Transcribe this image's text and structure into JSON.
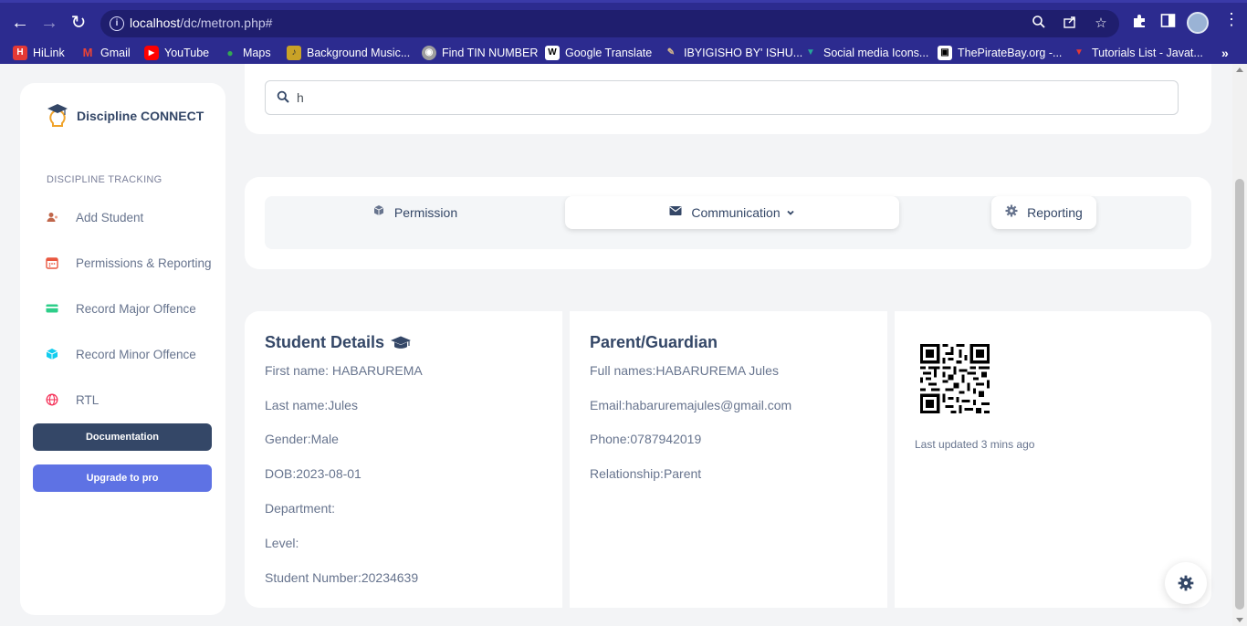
{
  "browser": {
    "url_host": "localhost",
    "url_path": "/dc/metron.php#",
    "bookmarks": [
      {
        "label": "HiLink",
        "color": "#e53935",
        "glyph": "H"
      },
      {
        "label": "Gmail",
        "color": "#ea4335",
        "glyph": "M"
      },
      {
        "label": "YouTube",
        "color": "#ff0000",
        "glyph": "▶"
      },
      {
        "label": "Maps",
        "color": "#34a853",
        "glyph": "●"
      },
      {
        "label": "Background Music...",
        "color": "#c9a227",
        "glyph": "♪"
      },
      {
        "label": "Find TIN NUMBER",
        "color": "#9e9e9e",
        "glyph": "◉"
      },
      {
        "label": "Google Translate",
        "color": "#ffffff",
        "glyph": "W"
      },
      {
        "label": "IBYIGISHO BY' ISHU...",
        "color": "#795548",
        "glyph": "✎"
      },
      {
        "label": "Social media Icons...",
        "color": "#26a69a",
        "glyph": "▼"
      },
      {
        "label": "ThePirateBay.org -...",
        "color": "#ffffff",
        "glyph": "▣"
      },
      {
        "label": "Tutorials List - Javat...",
        "color": "#e53935",
        "glyph": "▼"
      }
    ]
  },
  "sidebar": {
    "brand": "Discipline CONNECT",
    "section_title": "DISCIPLINE TRACKING",
    "items": [
      {
        "label": "Add Student",
        "icon": "user-icon",
        "color": "#c0664a"
      },
      {
        "label": "Permissions & Reporting",
        "icon": "calendar-icon",
        "color": "#e9573f"
      },
      {
        "label": "Record Major Offence",
        "icon": "credit-card-icon",
        "color": "#2dce89"
      },
      {
        "label": "Record Minor Offence",
        "icon": "cube-icon",
        "color": "#11cdef"
      },
      {
        "label": "RTL",
        "icon": "globe-icon",
        "color": "#f5365c"
      }
    ],
    "documentation_label": "Documentation",
    "upgrade_label": "Upgrade to pro"
  },
  "search": {
    "value": "h"
  },
  "tabs": [
    {
      "label": "Permission",
      "icon": "box-icon"
    },
    {
      "label": "Communication",
      "icon": "envelope-icon"
    },
    {
      "label": "Reporting",
      "icon": "gear-icon"
    }
  ],
  "student": {
    "title": "Student Details",
    "first_name": "First name: HABARUREMA",
    "last_name": "Last name:Jules",
    "gender": "Gender:Male",
    "dob": "DOB:2023-08-01",
    "department": "Department:",
    "level": "Level:",
    "student_number": "Student Number:20234639"
  },
  "parent": {
    "title": "Parent/Guardian",
    "full_names": "Full names:HABARUREMA Jules",
    "email": "Email:habaruremajules@gmail.com",
    "phone": "Phone:0787942019",
    "relationship": "Relationship:Parent"
  },
  "qr_card": {
    "updated": "Last updated 3 mins ago"
  },
  "colors": {
    "chrome": "#2c2b8f",
    "primary_dark": "#344767",
    "primary": "#5e72e4",
    "text_muted": "#67748e"
  }
}
